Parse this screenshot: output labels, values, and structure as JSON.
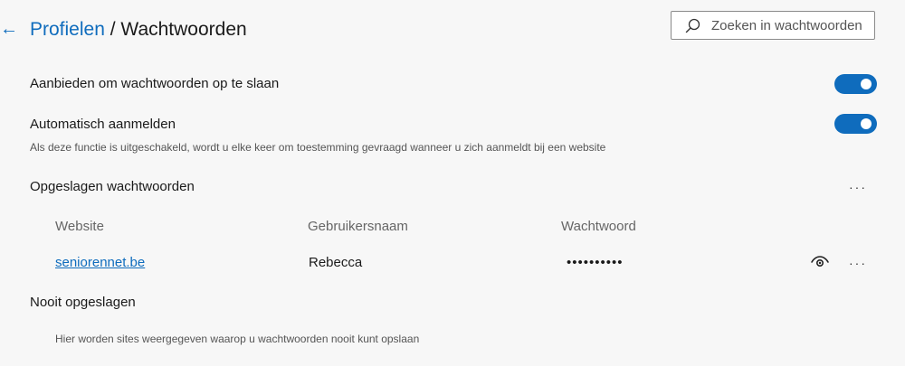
{
  "header": {
    "back_icon": "←",
    "breadcrumb_parent": "Profielen",
    "breadcrumb_separator": " / ",
    "breadcrumb_current": "Wachtwoorden"
  },
  "search": {
    "placeholder": "Zoeken in wachtwoorden",
    "icon": "search-icon"
  },
  "settings": {
    "offer_save": {
      "label": "Aanbieden om wachtwoorden op te slaan",
      "enabled": true
    },
    "auto_signin": {
      "label": "Automatisch aanmelden",
      "description": "Als deze functie is uitgeschakeld, wordt u elke keer om toestemming gevraagd wanneer u zich aanmeldt bij een website",
      "enabled": true
    }
  },
  "saved": {
    "heading": "Opgeslagen wachtwoorden",
    "more": "···",
    "columns": [
      "Website",
      "Gebruikersnaam",
      "Wachtwoord"
    ],
    "rows": [
      {
        "website": "seniorennet.be",
        "username": "Rebecca",
        "password": "••••••••••",
        "more": "···"
      }
    ]
  },
  "never_saved": {
    "heading": "Nooit opgeslagen",
    "empty_text": "Hier worden sites weergegeven waarop u wachtwoorden nooit kunt opslaan"
  },
  "colors": {
    "accent": "#0f6cbd",
    "background": "#f7f7f7"
  }
}
